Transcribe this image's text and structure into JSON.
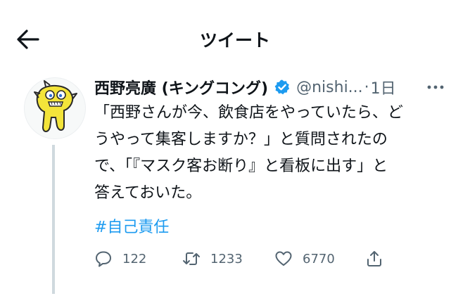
{
  "header": {
    "title": "ツイート"
  },
  "tweet": {
    "display_name": "西野亮廣 (キングコング)",
    "handle": "@nishi...",
    "separator": "·",
    "time": "1日",
    "text_lines": [
      "「西野さんが今、飲食店をやっていたら、ど",
      "うやって集客しますか？」と質問されたの",
      "で、「『マスク客お断り』と看板に出す」と",
      "答えておいた。"
    ],
    "hashtag": "#自己責任"
  },
  "actions": {
    "reply_count": "122",
    "retweet_count": "1233",
    "like_count": "6770"
  },
  "colors": {
    "accent": "#1d9bf0",
    "text": "#0f1419",
    "secondary": "#536471",
    "avatar_yellow": "#f3e43a"
  },
  "icons": [
    "back-arrow-icon",
    "verified-badge-icon",
    "more-icon",
    "reply-icon",
    "retweet-icon",
    "like-icon",
    "share-icon"
  ]
}
